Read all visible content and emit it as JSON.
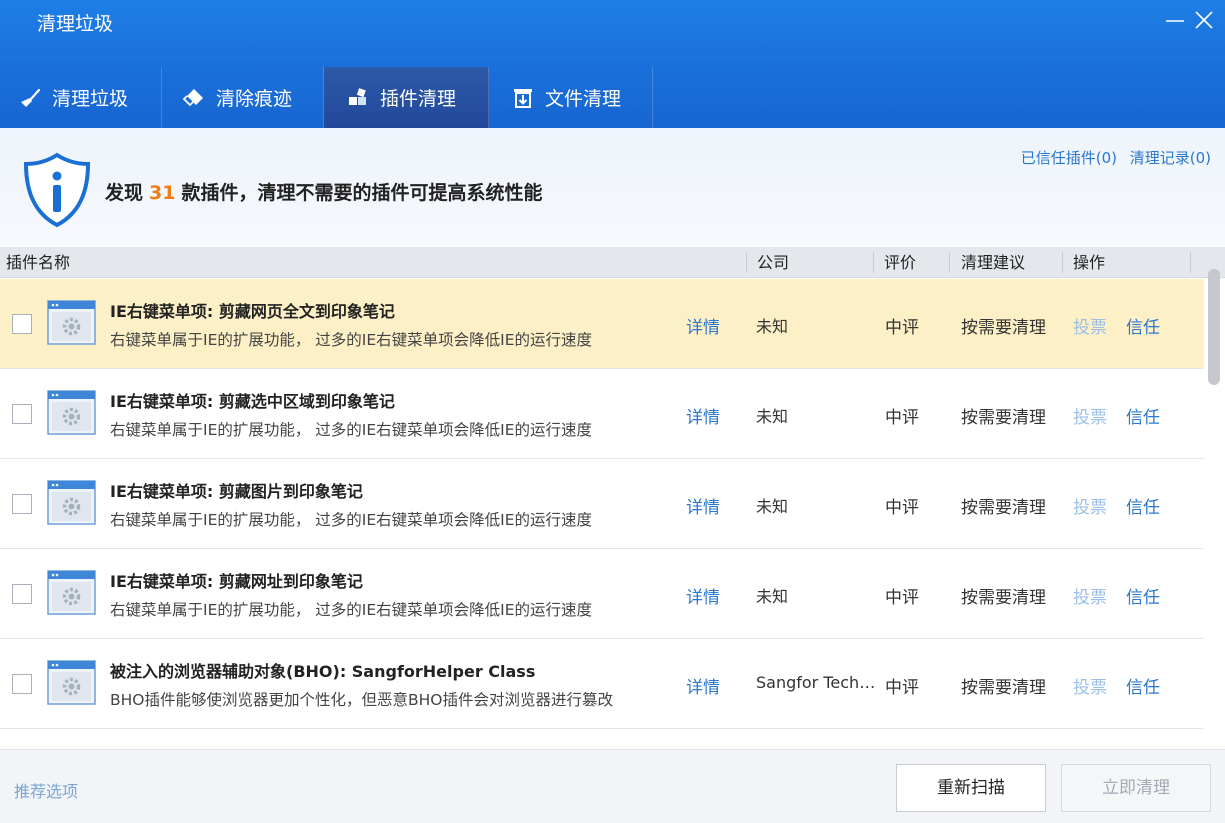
{
  "window": {
    "title": "清理垃圾"
  },
  "tabs": [
    {
      "label": "清理垃圾",
      "icon": "broom-icon",
      "active": false
    },
    {
      "label": "清除痕迹",
      "icon": "eraser-icon",
      "active": false
    },
    {
      "label": "插件清理",
      "icon": "plugin-blocks-icon",
      "active": true
    },
    {
      "label": "文件清理",
      "icon": "trash-bin-icon",
      "active": false
    }
  ],
  "info": {
    "prefix": "发现",
    "count": "31",
    "suffix": "款插件，清理不需要的插件可提高系统性能",
    "link_trusted": "已信任插件(0)",
    "link_history": "清理记录(0)"
  },
  "table": {
    "columns": {
      "name": "插件名称",
      "company": "公司",
      "rating": "评价",
      "advice": "清理建议",
      "action": "操作"
    },
    "rows": [
      {
        "name": "IE右键菜单项: 剪藏网页全文到印象笔记",
        "desc": "右键菜单属于IE的扩展功能， 过多的IE右键菜单项会降低IE的运行速度",
        "detail": "详情",
        "company": "未知",
        "rating": "中评",
        "advice": "按需要清理",
        "vote": "投票",
        "trust": "信任",
        "selected": true,
        "checked": false
      },
      {
        "name": "IE右键菜单项: 剪藏选中区域到印象笔记",
        "desc": "右键菜单属于IE的扩展功能， 过多的IE右键菜单项会降低IE的运行速度",
        "detail": "详情",
        "company": "未知",
        "rating": "中评",
        "advice": "按需要清理",
        "vote": "投票",
        "trust": "信任",
        "selected": false,
        "checked": false
      },
      {
        "name": "IE右键菜单项: 剪藏图片到印象笔记",
        "desc": "右键菜单属于IE的扩展功能， 过多的IE右键菜单项会降低IE的运行速度",
        "detail": "详情",
        "company": "未知",
        "rating": "中评",
        "advice": "按需要清理",
        "vote": "投票",
        "trust": "信任",
        "selected": false,
        "checked": false
      },
      {
        "name": "IE右键菜单项: 剪藏网址到印象笔记",
        "desc": "右键菜单属于IE的扩展功能， 过多的IE右键菜单项会降低IE的运行速度",
        "detail": "详情",
        "company": "未知",
        "rating": "中评",
        "advice": "按需要清理",
        "vote": "投票",
        "trust": "信任",
        "selected": false,
        "checked": false
      },
      {
        "name": "被注入的浏览器辅助对象(BHO): SangforHelper Class",
        "desc": "BHO插件能够使浏览器更加个性化，但恶意BHO插件会对浏览器进行篡改",
        "detail": "详情",
        "company": "Sangfor Technologies",
        "rating": "中评",
        "advice": "按需要清理",
        "vote": "投票",
        "trust": "信任",
        "selected": false,
        "checked": false
      }
    ]
  },
  "footer": {
    "recommend": "推荐选项",
    "rescan": "重新扫描",
    "clean_now": "立即清理"
  },
  "colors": {
    "titlebar": "#1e7fe6",
    "active_tab": "#22489a",
    "highlight_count": "#f07c12",
    "link": "#2a78d0",
    "selected_row": "#fdf0c6"
  }
}
